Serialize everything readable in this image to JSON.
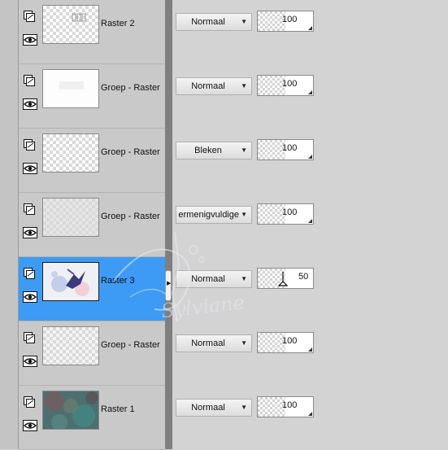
{
  "layers_panel": {
    "layers": [
      {
        "name": "Raster 2",
        "blend_mode": "Normaal",
        "opacity": "100",
        "thumbnail": "checkerboard-sparse",
        "selected": false
      },
      {
        "name": "Groep - Raster",
        "blend_mode": "Normaal",
        "opacity": "100",
        "thumbnail": "checkerboard-white",
        "selected": false
      },
      {
        "name": "Groep - Raster",
        "blend_mode": "Bleken",
        "opacity": "100",
        "thumbnail": "checkerboard",
        "selected": false
      },
      {
        "name": "Groep - Raster",
        "blend_mode": "ermenigvuldige",
        "opacity": "100",
        "thumbnail": "checkerboard-grey",
        "selected": false
      },
      {
        "name": "Raster 3",
        "blend_mode": "Normaal",
        "opacity": "50",
        "thumbnail": "flower-bird",
        "selected": true
      },
      {
        "name": "Groep - Raster",
        "blend_mode": "Normaal",
        "opacity": "100",
        "thumbnail": "checkerboard-faint",
        "selected": false
      },
      {
        "name": "Raster 1",
        "blend_mode": "Normaal",
        "opacity": "100",
        "thumbnail": "teal-texture",
        "selected": false
      }
    ]
  },
  "watermark": {
    "text": "Sylviane"
  },
  "colors": {
    "selection": "#3d9bf5",
    "panel_background": "#d2d2d2",
    "divider": "#7f7f7f"
  }
}
